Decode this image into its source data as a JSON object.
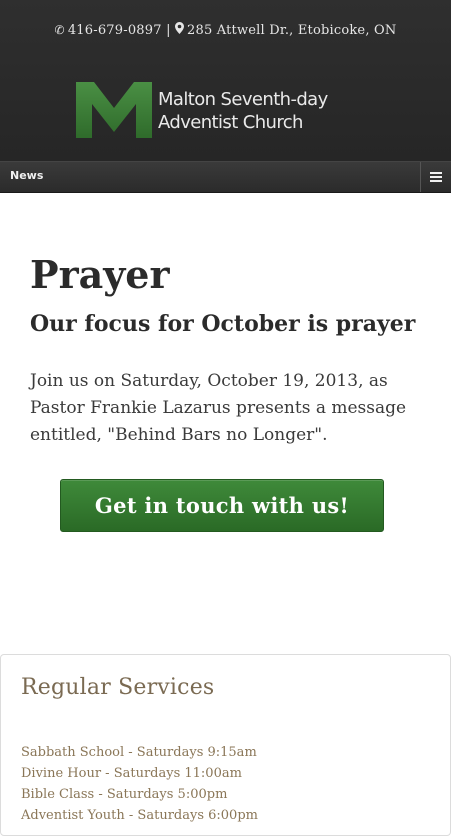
{
  "header": {
    "phone": "416-679-0897",
    "separator": "|",
    "address": "285 Attwell Dr., Etobicoke, ON",
    "logo_line1": "Malton Seventh-day",
    "logo_line2": "Adventist Church"
  },
  "nav": {
    "item": "News"
  },
  "main": {
    "title": "Prayer",
    "subtitle": "Our focus for October is prayer",
    "body": "Join us on Saturday, October 19, 2013, as Pastor Frankie Lazarus presents a message entitled, \"Behind Bars no Longer\".",
    "cta_label": "Get in touch with us!"
  },
  "services": {
    "title": "Regular Services",
    "items": [
      "Sabbath School - Saturdays 9:15am",
      "Divine Hour - Saturdays 11:00am",
      "Bible Class - Saturdays 5:00pm",
      "Adventist Youth - Saturdays 6:00pm"
    ]
  },
  "colors": {
    "header_bg": "#2a2a2a",
    "accent_green": "#3a7d35",
    "services_text": "#8a7657"
  },
  "icons": [
    "phone-icon",
    "map-marker-icon",
    "menu-icon"
  ]
}
